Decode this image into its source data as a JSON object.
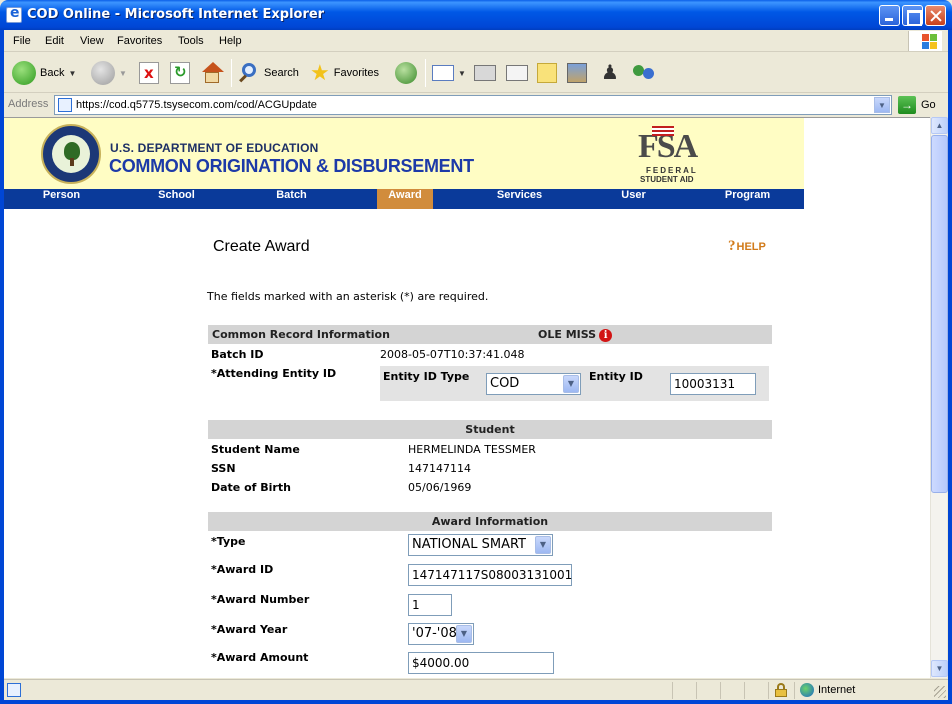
{
  "window": {
    "title": "COD Online - Microsoft Internet Explorer"
  },
  "menu": [
    "File",
    "Edit",
    "View",
    "Favorites",
    "Tools",
    "Help"
  ],
  "toolbar": {
    "back": "Back",
    "search": "Search",
    "favorites": "Favorites"
  },
  "address": {
    "label": "Address",
    "url": "https://cod.q5775.tsysecom.com/cod/ACGUpdate",
    "go": "Go"
  },
  "banner": {
    "dept_line1": "U.S. DEPARTMENT OF EDUCATION",
    "dept_line2": "COMMON ORIGINATION & DISBURSEMENT",
    "fsa_big": "FSA",
    "fsa_line1": "FEDERAL",
    "fsa_line2": "STUDENT AID"
  },
  "nav": [
    "Person",
    "School",
    "Batch",
    "Award",
    "Services",
    "User",
    "Program"
  ],
  "nav_active": "Award",
  "page": {
    "title": "Create Award",
    "help": "HELP",
    "required_note": "The fields marked with an asterisk (*) are required."
  },
  "common": {
    "header": "Common Record Information",
    "school": "OLE MISS",
    "batch_label": "Batch ID",
    "batch_value": "2008-05-07T10:37:41.048",
    "entity_label": "*Attending Entity ID",
    "entity_type_label": "Entity ID Type",
    "entity_type_value": "COD",
    "entity_id_label": "Entity ID",
    "entity_id_value": "10003131"
  },
  "student": {
    "header": "Student",
    "name_label": "Student Name",
    "name_value": "HERMELINDA TESSMER",
    "ssn_label": "SSN",
    "ssn_value": "147147114",
    "dob_label": "Date of Birth",
    "dob_value": "05/06/1969"
  },
  "award": {
    "header": "Award Information",
    "type_label": "*Type",
    "type_value": "NATIONAL SMART",
    "id_label": "*Award ID",
    "id_value": "147147117S08003131001",
    "number_label": "*Award Number",
    "number_value": "1",
    "year_label": "*Award Year",
    "year_value": "'07-'08",
    "amount_label": "*Award Amount",
    "amount_value": "$4000.00"
  },
  "status": {
    "zone": "Internet"
  }
}
